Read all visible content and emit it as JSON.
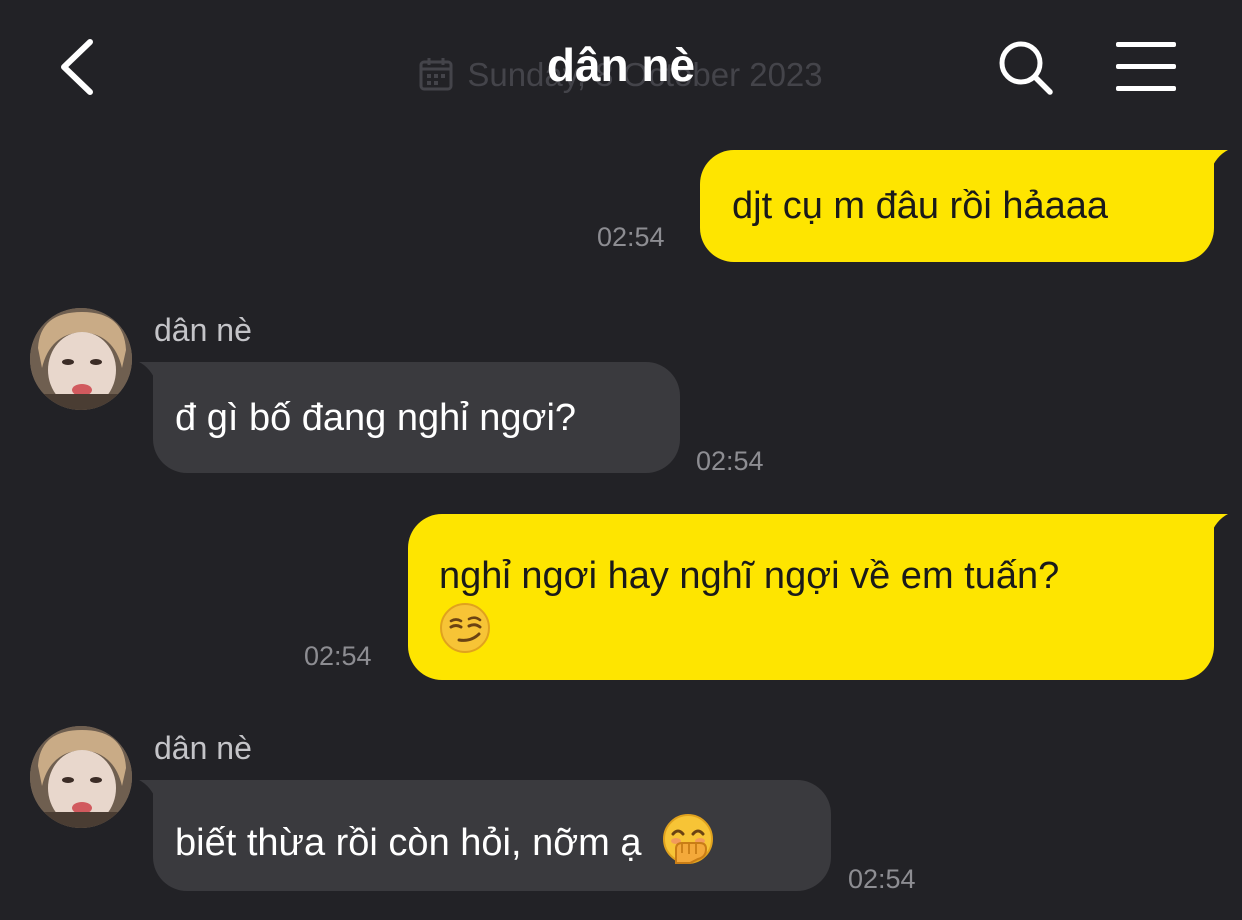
{
  "header": {
    "title": "dân nè",
    "date_separator": "Sunday, 8 October 2023",
    "icons": {
      "back": "chevron-left-icon",
      "search": "search-icon",
      "menu": "hamburger-menu-icon",
      "date": "calendar-icon"
    }
  },
  "colors": {
    "background": "#222226",
    "outgoing_bubble": "#fee500",
    "incoming_bubble": "#3a3a3e"
  },
  "messages": [
    {
      "direction": "out",
      "text": "djt cụ m đâu rồi hảaaa",
      "time": "02:54"
    },
    {
      "direction": "in",
      "sender": "dân nè",
      "text": "đ gì bố đang nghỉ ngơi?",
      "time": "02:54"
    },
    {
      "direction": "out",
      "text": "nghỉ ngơi hay nghĩ ngợi về em tuấn?",
      "emoji": "smirking-face-emoji",
      "time": "02:54"
    },
    {
      "direction": "in",
      "sender": "dân nè",
      "text": "biết thừa rồi còn hỏi, nỡm ạ",
      "emoji": "face-with-hand-over-mouth-emoji",
      "time": "02:54"
    }
  ]
}
